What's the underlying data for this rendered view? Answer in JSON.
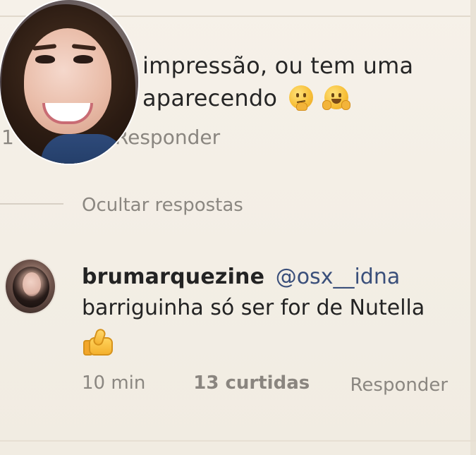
{
  "parent_comment": {
    "text_lines": [
      "impressão, ou tem uma",
      "aparecendo"
    ],
    "emojis": [
      "thinking-face-icon",
      "hugging-face-icon"
    ],
    "time_partial": "1",
    "reply_action": "Responder"
  },
  "thread": {
    "hide_replies": "Ocultar respostas"
  },
  "reply": {
    "username": "brumarquezine",
    "mention": "@osx__idna",
    "text": "barriguinha só ser for de Nutella",
    "emoji": "thumbs-up-icon",
    "time": "10 min",
    "likes": "13 curtidas",
    "reply_action": "Responder"
  }
}
